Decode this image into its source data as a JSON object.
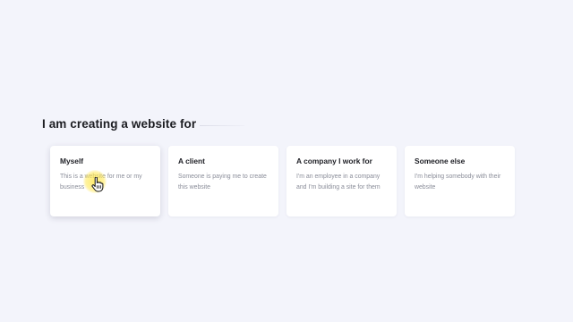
{
  "heading": "I am creating a website for",
  "options": [
    {
      "title": "Myself",
      "description": "This is a website for me or my business",
      "selected": true
    },
    {
      "title": "A client",
      "description": "Someone is paying me to create this website",
      "selected": false
    },
    {
      "title": "A company I work for",
      "description": "I'm an employee in a company and I'm building a site for them",
      "selected": false
    },
    {
      "title": "Someone else",
      "description": "I'm helping somebody with their website",
      "selected": false
    }
  ],
  "cursor": {
    "icon": "hand-pointer-icon",
    "highlight_color": "#ffe850"
  },
  "colors": {
    "background": "#f3f4fb",
    "card": "#ffffff",
    "title_text": "#1e1f25",
    "description_text": "#8a8d99"
  }
}
